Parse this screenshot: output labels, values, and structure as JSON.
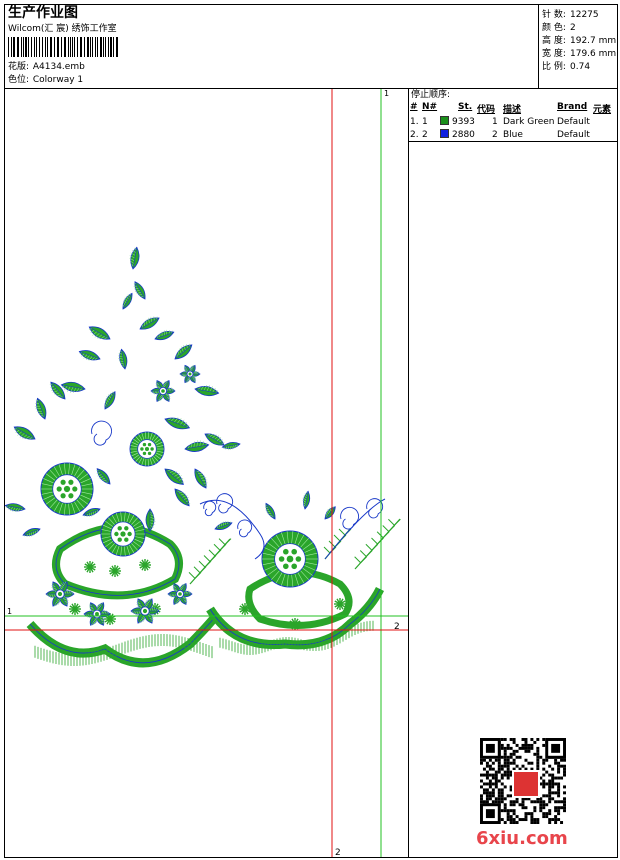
{
  "header": {
    "title": "生产作业图",
    "company": "Wilcom(汇 宸) 绣饰工作室",
    "design_label": "花版:",
    "design_value": "A4134.emb",
    "colorway_label": "色位:",
    "colorway_value": "Colorway 1"
  },
  "stats": [
    {
      "label": "针 数:",
      "value": "12275"
    },
    {
      "label": "颜 色:",
      "value": "2"
    },
    {
      "label": "高 度:",
      "value": "192.7 mm"
    },
    {
      "label": "宽 度:",
      "value": "179.6 mm"
    },
    {
      "label": "比 例:",
      "value": "0.74"
    }
  ],
  "stop_sequence": {
    "title": "停止顺序:",
    "headers": {
      "hash": "#",
      "no": "N#",
      "st": "St.",
      "code": "代码",
      "desc": "描述",
      "brand": "Brand",
      "element": "元素"
    },
    "rows": [
      {
        "idx": "1.",
        "no": "1",
        "color": "#1a8f1a",
        "st": "9393",
        "code": "1",
        "desc": "Dark Green",
        "brand": "Default"
      },
      {
        "idx": "2.",
        "no": "2",
        "color": "#1020e0",
        "st": "2880",
        "code": "2",
        "desc": "Blue",
        "brand": "Default"
      }
    ]
  },
  "guides": {
    "green_label_top": "1",
    "green_label_left": "1",
    "red_label_right": "2",
    "red_label_bottom": "2",
    "green_color": "#21c121",
    "red_color": "#e01010"
  },
  "colors": {
    "embroidery_green": "#2aa52a",
    "embroidery_blue": "#1838c8"
  },
  "watermark": {
    "text": "6xiu.com",
    "stamp_icon": "seal-stamp-icon"
  }
}
